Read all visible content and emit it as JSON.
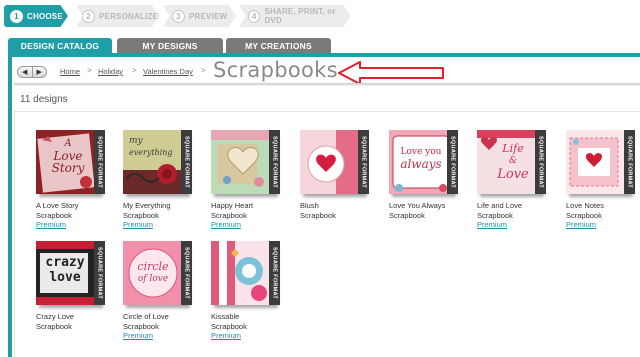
{
  "steps": [
    {
      "num": "1",
      "label": "CHOOSE"
    },
    {
      "num": "2",
      "label": "PERSONALIZE"
    },
    {
      "num": "3",
      "label": "PREVIEW"
    },
    {
      "num": "4",
      "label": "SHARE, PRINT, or DVD"
    }
  ],
  "tabs": {
    "design_catalog": "DESIGN CATALOG",
    "my_designs": "MY DESIGNS",
    "my_creations": "MY CREATIONS"
  },
  "nav": {
    "back": "◀",
    "forward": "▶"
  },
  "breadcrumb": {
    "home": "Home",
    "holiday": "Holiday",
    "valentines": "Valentines Day",
    "separator": ">",
    "current": "Scrapbooks"
  },
  "count": "11 designs",
  "badge": "SQUARE FORMAT",
  "designs": [
    {
      "line1": "A Love Story",
      "line2": "Scrapbook",
      "premium": "Premium"
    },
    {
      "line1": "My Everything",
      "line2": "Scrapbook",
      "premium": "Premium"
    },
    {
      "line1": "Happy Heart",
      "line2": "Scrapbook",
      "premium": "Premium"
    },
    {
      "line1": "Blush",
      "line2": "Scrapbook",
      "premium": ""
    },
    {
      "line1": "Love You Always",
      "line2": "Scrapbook",
      "premium": ""
    },
    {
      "line1": "Life and Love",
      "line2": "Scrapbook",
      "premium": "Premium"
    },
    {
      "line1": "Love Notes",
      "line2": "Scrapbook",
      "premium": "Premium"
    },
    {
      "line1": "Crazy Love",
      "line2": "Scrapbook",
      "premium": ""
    },
    {
      "line1": "Circle of Love",
      "line2": "Scrapbook",
      "premium": "Premium"
    },
    {
      "line1": "Kissable",
      "line2": "Scrapbook",
      "premium": "Premium"
    }
  ],
  "thumb_text": {
    "love_story": [
      "A",
      "Love",
      "Story"
    ],
    "my_everything": [
      "my",
      "everything"
    ],
    "love_you_always": [
      "Love you",
      "always"
    ],
    "life_love": [
      "Life",
      "&",
      "Love"
    ],
    "crazy_love": [
      "crazy",
      "love"
    ],
    "circle_love": [
      "circle",
      "of love"
    ]
  },
  "colors": {
    "accent": "#1e9ea6",
    "tab_inactive": "#7a7a7a",
    "link": "#1e8fb0",
    "annotation": "#e0202a"
  }
}
